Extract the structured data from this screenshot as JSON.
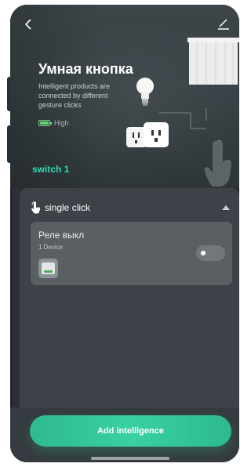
{
  "header": {
    "title": "Умная кнопка",
    "subtitle": "Intelligent products are connected by different gesture clicks",
    "battery_label": "High",
    "switch_name": "switch 1"
  },
  "icons": {
    "back": "chevron-left-icon",
    "edit": "pencil-icon",
    "battery": "battery-full-icon",
    "gesture": "tap-hand-icon",
    "collapse": "caret-up-icon"
  },
  "section": {
    "label": "single click"
  },
  "rule": {
    "name": "Реле выкл",
    "device_count": "1 Device",
    "enabled": false
  },
  "footer": {
    "add_button_label": "Add intelligence"
  },
  "colors": {
    "accent": "#34d9b0",
    "button": "#35c79a",
    "background": "#2a3035",
    "card": "#3c4247",
    "rule_card": "#5a5f63"
  }
}
